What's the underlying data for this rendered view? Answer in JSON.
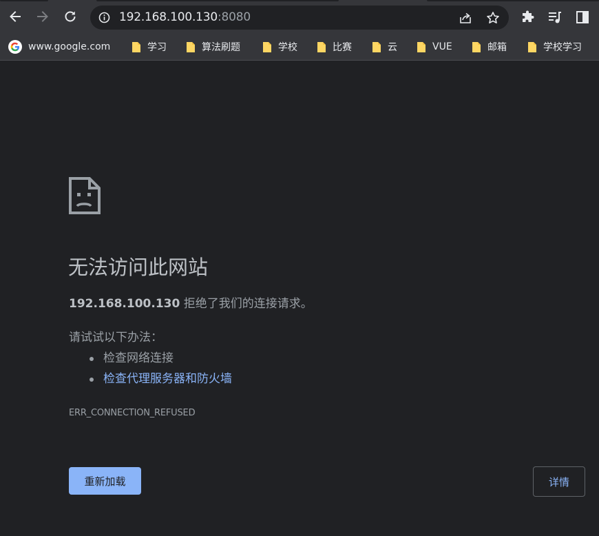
{
  "browser": {
    "address_bar": {
      "host": "192.168.100.130",
      "port": ":8080"
    },
    "icons": {
      "back": "back-arrow-icon",
      "forward": "forward-arrow-icon",
      "reload": "reload-icon",
      "site_info": "info-icon",
      "share": "share-icon",
      "bookmark": "star-icon",
      "extensions": "puzzle-icon",
      "media": "media-control-icon",
      "side_panel": "side-panel-icon"
    }
  },
  "bookmarks": [
    {
      "label": "www.google.com",
      "icon": "google-icon"
    },
    {
      "label": "学习",
      "icon": "folder-icon"
    },
    {
      "label": "算法刷题",
      "icon": "folder-icon"
    },
    {
      "label": "学校",
      "icon": "folder-icon"
    },
    {
      "label": "比赛",
      "icon": "folder-icon"
    },
    {
      "label": "云",
      "icon": "folder-icon"
    },
    {
      "label": "VUE",
      "icon": "folder-icon"
    },
    {
      "label": "邮箱",
      "icon": "folder-icon"
    },
    {
      "label": "学校学习",
      "icon": "folder-icon"
    }
  ],
  "error": {
    "title": "无法访问此网站",
    "host": "192.168.100.130",
    "description": " 拒绝了我们的连接请求。",
    "try_label": "请试试以下办法：",
    "suggestions": [
      {
        "text": "检查网络连接",
        "is_link": false
      },
      {
        "text": "检查代理服务器和防火墙",
        "is_link": true
      }
    ],
    "code": "ERR_CONNECTION_REFUSED",
    "reload_label": "重新加载",
    "details_label": "详情"
  },
  "colors": {
    "background": "#202124",
    "toolbar": "#35363a",
    "link": "#8ab4f8",
    "text": "#9aa0a6",
    "folder": "#fdd663"
  }
}
